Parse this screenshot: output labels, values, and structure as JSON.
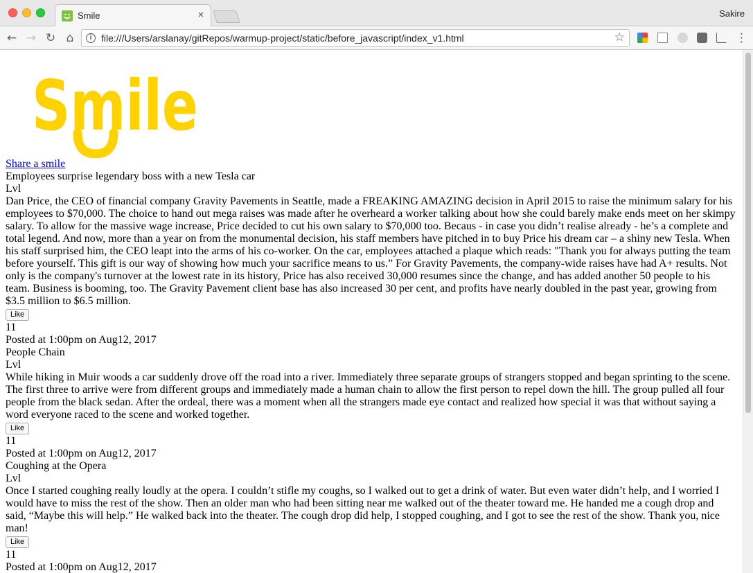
{
  "window": {
    "tab_title": "Smile",
    "tab_close": "×",
    "profile_name": "Sakire"
  },
  "toolbar": {
    "back_icon": "←",
    "forward_icon": "→",
    "reload_icon": "↻",
    "home_icon": "⌂",
    "info_icon": "i",
    "url": "file:///Users/arslanay/gitRepos/warmup-project/static/before_javascript/index_v1.html",
    "star_icon": "☆",
    "menu_icon": "⋮"
  },
  "brand": {
    "logo_text": "Smile",
    "logo_color": "#ffd200"
  },
  "page": {
    "share_link": "Share a smile",
    "stories": [
      {
        "title": "Employees surprise legendary boss with a new Tesla car",
        "level": "Lvl",
        "body": "Dan Price, the CEO of financial company Gravity Pavements in Seattle, made a FREAKING AMAZING decision in April 2015 to raise the minimum salary for his employees to $70,000. The choice to hand out mega raises was made after he overheard a worker talking about how she could barely make ends meet on her skimpy salary. To allow for the massive wage increase, Price decided to cut his own salary to $70,000 too. Becaus - in case you didn’t realise already - he’s a complete and total legend. And now, more than a year on from the monumental decision, his staff members have pitched in to buy Price his dream car – a shiny new Tesla. When his staff surprised him, the CEO leapt into the arms of his co-worker. On the car, employees attached a plaque which reads: \"Thank you for always putting the team before yourself. This gift is our way of showing how much your sacrifice means to us.” For Gravity Pavements, the company-wide raises have had A+ results. Not only is the company's turnover at the lowest rate in its history, Price has also received 30,000 resumes since the change, and has added another 50 people to his team. Business is booming, too. The Gravity Pavement client base has also increased 30 per cent, and profits have nearly doubled in the past year, growing from $3.5 million to $6.5 million.",
        "like_label": "Like",
        "likes": "11",
        "posted": "Posted at 1:00pm on Aug12, 2017"
      },
      {
        "title": "People Chain",
        "level": "Lvl",
        "body": "While hiking in Muir woods a car suddenly drove off the road into a river. Immediately three separate groups of strangers stopped and began sprinting to the scene. The first three to arrive were from different groups and immediately made a human chain to allow the first person to repel down the hill. The group pulled all four people from the black sedan. After the ordeal, there was a moment when all the strangers made eye contact and realized how special it was that without saying a word everyone raced to the scene and worked together.",
        "like_label": "Like",
        "likes": "11",
        "posted": "Posted at 1:00pm on Aug12, 2017"
      },
      {
        "title": "Coughing at the Opera",
        "level": "Lvl",
        "body": "Once I started coughing really loudly at the opera. I couldn’t stifle my coughs, so I walked out to get a drink of water. But even water didn’t help, and I worried I would have to miss the rest of the show. Then an older man who had been sitting near me walked out of the theater toward me. He handed me a cough drop and said, “Maybe this will help.” He walked back into the theater. The cough drop did help, I stopped coughing, and I got to see the rest of the show. Thank you, nice man!",
        "like_label": "Like",
        "likes": "11",
        "posted": "Posted at 1:00pm on Aug12, 2017"
      }
    ]
  }
}
